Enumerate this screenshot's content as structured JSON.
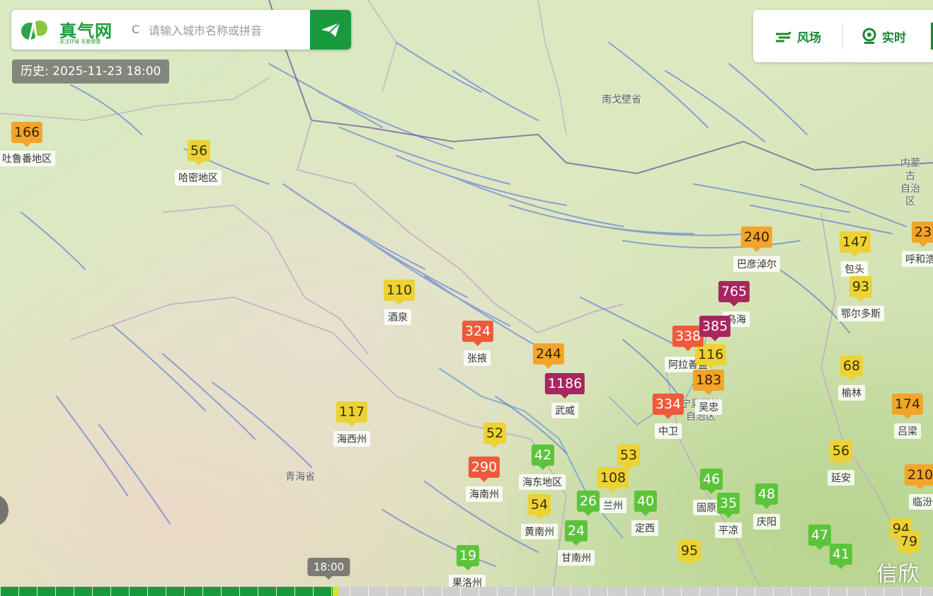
{
  "search": {
    "logo_text": "真气网",
    "logo_slogan": "关注环境 关爱健康",
    "refresh_icon": "refresh-icon",
    "placeholder": "请输入城市名称或拼音",
    "send_icon": "send-icon"
  },
  "panel": {
    "wind_label": "风场",
    "live_label": "实时"
  },
  "history_label": "历史: 2025-11-23 18:00",
  "timeline": {
    "time_label": "18:00",
    "progress": 0.36
  },
  "watermark": "信欣",
  "colors": {
    "good": "#5cc43a",
    "moderate": "#ecd235",
    "usg": "#f2a52a",
    "unhealthy": "#ef5a3c",
    "very_unhealthy": "#a8265e",
    "brand": "#179a3e"
  },
  "markers": [
    {
      "value": "166",
      "level": "usg"
    },
    {
      "value": "56",
      "level": "moderate"
    },
    {
      "value": "110",
      "level": "moderate"
    },
    {
      "value": "324",
      "level": "unhealthy"
    },
    {
      "value": "244",
      "level": "usg"
    },
    {
      "value": "1186",
      "level": "very"
    },
    {
      "value": "117",
      "level": "moderate"
    },
    {
      "value": "52",
      "level": "moderate"
    },
    {
      "value": "42",
      "level": "good"
    },
    {
      "value": "290",
      "level": "unhealthy"
    },
    {
      "value": "54",
      "level": "moderate"
    },
    {
      "value": "26",
      "level": "good"
    },
    {
      "value": "24",
      "level": "good"
    },
    {
      "value": "19",
      "level": "good"
    },
    {
      "value": "53",
      "level": "moderate"
    },
    {
      "value": "108",
      "level": "moderate"
    },
    {
      "value": "40",
      "level": "good"
    },
    {
      "value": "334",
      "level": "unhealthy"
    },
    {
      "value": "183",
      "level": "usg"
    },
    {
      "value": "116",
      "level": "moderate"
    },
    {
      "value": "338",
      "level": "unhealthy"
    },
    {
      "value": "385",
      "level": "very"
    },
    {
      "value": "765",
      "level": "very"
    },
    {
      "value": "240",
      "level": "usg"
    },
    {
      "value": "147",
      "level": "moderate"
    },
    {
      "value": "93",
      "level": "moderate"
    },
    {
      "value": "68",
      "level": "moderate"
    },
    {
      "value": "174",
      "level": "usg"
    },
    {
      "value": "56",
      "level": "moderate"
    },
    {
      "value": "46",
      "level": "good"
    },
    {
      "value": "35",
      "level": "good"
    },
    {
      "value": "48",
      "level": "good"
    },
    {
      "value": "47",
      "level": "good"
    },
    {
      "value": "41",
      "level": "good"
    },
    {
      "value": "95",
      "level": "moderate"
    },
    {
      "value": "94",
      "level": "moderate"
    },
    {
      "value": "79",
      "level": "moderate"
    },
    {
      "value": "210",
      "level": "usg"
    },
    {
      "value": "23",
      "level": "usg"
    }
  ],
  "city_labels": [
    "吐鲁番地区",
    "哈密地区",
    "酒泉",
    "张掖",
    "武威",
    "海西州",
    "海东地区",
    "海南州",
    "黄南州",
    "甘南州",
    "果洛州",
    "定西",
    "中卫",
    "吴忠",
    "阿拉善盟",
    "乌海",
    "巴彦淖尔",
    "包头",
    "鄂尔多斯",
    "榆林",
    "吕梁",
    "延安",
    "庆阳",
    "平凉",
    "临汾",
    "呼和浩",
    "兰州",
    "固原"
  ],
  "region_labels": [
    "南戈壁省",
    "内蒙古\n自治区",
    "青海省",
    "宁夏回族\n自治区"
  ]
}
